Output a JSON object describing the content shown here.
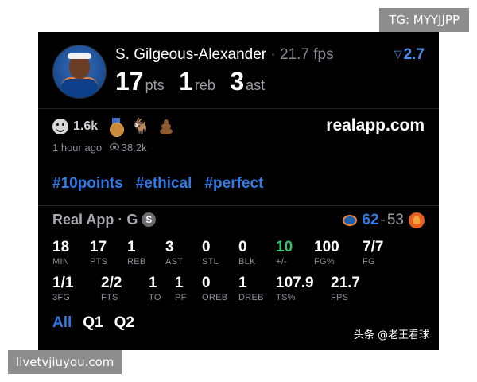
{
  "overlay": {
    "tg_label": "TG: MYYJJPP",
    "site_label": "livetvjiuyou.com"
  },
  "header": {
    "player_name": "S. Gilgeous-Alexander",
    "fps_text": "· 21.7 fps",
    "trend_value": "2.7",
    "line": [
      {
        "value": "17",
        "unit": "pts"
      },
      {
        "value": "1",
        "unit": "reb"
      },
      {
        "value": "3",
        "unit": "ast"
      }
    ]
  },
  "reactions": {
    "smile_count": "1.6k",
    "site": "realapp.com",
    "time_ago": "1 hour ago",
    "views": "38.2k",
    "icons": [
      "smile-icon",
      "medal-icon",
      "goat-icon",
      "poop-icon"
    ]
  },
  "hashtags": [
    "#10points",
    "#ethical",
    "#perfect"
  ],
  "game": {
    "title": "Real App · G",
    "badge": "S",
    "home_score": "62",
    "away_score": "53",
    "home_team_icon": "okc-logo-icon",
    "away_team_icon": "phx-logo-icon"
  },
  "stats_row1": [
    {
      "value": "18",
      "label": "MIN"
    },
    {
      "value": "17",
      "label": "PTS"
    },
    {
      "value": "1",
      "label": "REB"
    },
    {
      "value": "3",
      "label": "AST"
    },
    {
      "value": "0",
      "label": "STL"
    },
    {
      "value": "0",
      "label": "BLK"
    },
    {
      "value": "10",
      "label": "+/-",
      "color": "#35c26b"
    },
    {
      "value": "100",
      "label": "FG%"
    },
    {
      "value": "7/7",
      "label": "FG"
    }
  ],
  "stats_row2": [
    {
      "value": "1/1",
      "label": "3FG"
    },
    {
      "value": "2/2",
      "label": "FTS"
    },
    {
      "value": "1",
      "label": "TO"
    },
    {
      "value": "1",
      "label": "PF"
    },
    {
      "value": "0",
      "label": "OREB"
    },
    {
      "value": "1",
      "label": "DREB"
    },
    {
      "value": "107.9",
      "label": "TS%"
    },
    {
      "value": "21.7",
      "label": "FPS"
    }
  ],
  "tabs": [
    {
      "label": "All",
      "active": true
    },
    {
      "label": "Q1",
      "active": false
    },
    {
      "label": "Q2",
      "active": false
    }
  ],
  "watermark": "头条 @老王看球",
  "colors": {
    "accent": "#2f7ae5",
    "positive": "#35c26b",
    "background": "#000000"
  }
}
